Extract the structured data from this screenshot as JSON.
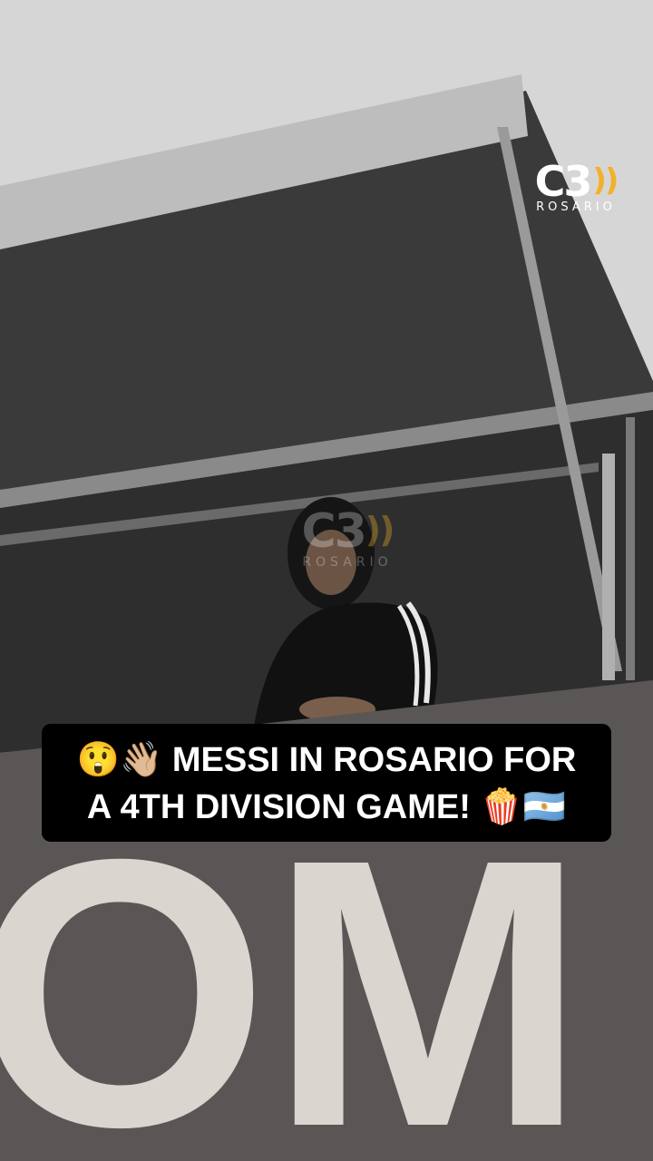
{
  "logo": {
    "mark": "C3",
    "sub": "ROSARIO"
  },
  "watermark": {
    "mark": "C3",
    "sub": "ROSARIO"
  },
  "caption": {
    "line1": "😲👋🏼 MESSI IN ROSARIO FOR",
    "line2": "A 4TH DIVISION GAME! 🍿🇦🇷"
  },
  "sign_text": "OM",
  "colors": {
    "logo_accent": "#f2b12a",
    "caption_bg": "#000000",
    "caption_text": "#ffffff"
  }
}
